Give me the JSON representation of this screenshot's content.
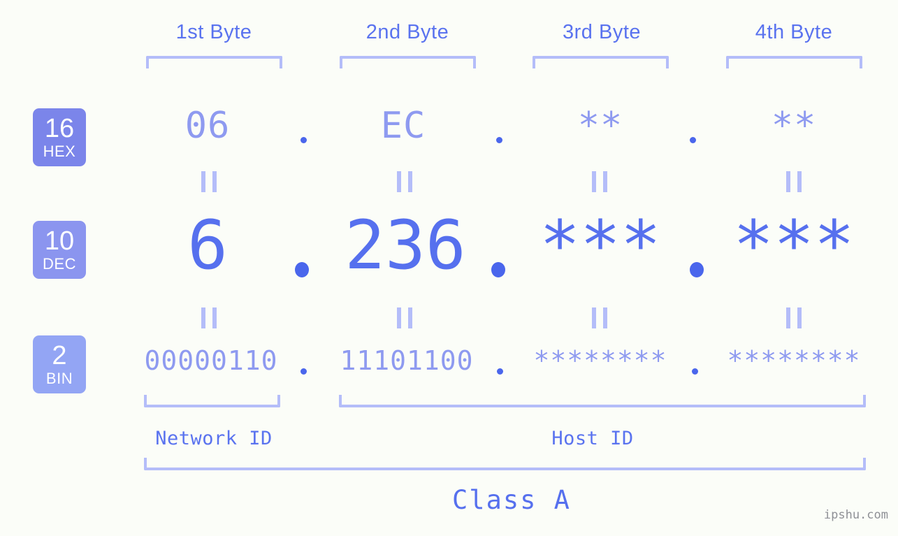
{
  "meta": {
    "background": "#fbfdf8",
    "accent_strong": "#5670ee",
    "accent_mid": "#8e9af0",
    "accent_light": "#b4bdf9",
    "watermark": "ipshu.com"
  },
  "byte_headers": [
    {
      "label": "1st Byte"
    },
    {
      "label": "2nd Byte"
    },
    {
      "label": "3rd Byte"
    },
    {
      "label": "4th Byte"
    }
  ],
  "rows": [
    {
      "badge_number": "16",
      "badge_name": "HEX",
      "badge_color": "#7b85ea",
      "values": [
        "06",
        "EC",
        "**",
        "**"
      ],
      "separator": "."
    },
    {
      "badge_number": "10",
      "badge_name": "DEC",
      "badge_color": "#8b95ef",
      "values": [
        "6",
        "236",
        "***",
        "***"
      ],
      "separator": "."
    },
    {
      "badge_number": "2",
      "badge_name": "BIN",
      "badge_color": "#93a5f4",
      "values": [
        "00000110",
        "11101100",
        "********",
        "********"
      ],
      "separator": "."
    }
  ],
  "equality_marks": {
    "symbol": "=",
    "count_per_row_gap": 4
  },
  "id_spans": [
    {
      "label": "Network ID"
    },
    {
      "label": "Host ID"
    }
  ],
  "class_span": {
    "label": "Class A"
  }
}
